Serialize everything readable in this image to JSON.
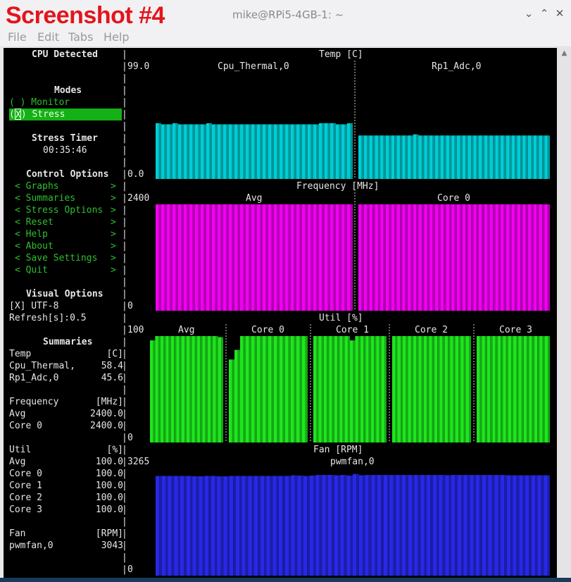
{
  "overlay_label": "Screenshot #4",
  "window": {
    "title": "mike@RPi5-4GB-1: ~",
    "min_icon": "chevron-down-icon",
    "max_icon": "chevron-up-icon",
    "close_icon": "close-icon"
  },
  "menu": [
    "File",
    "Edit",
    "Tabs",
    "Help"
  ],
  "left": {
    "cpu_detected": "CPU Detected",
    "modes_heading": "Modes",
    "mode_monitor": "( ) Monitor",
    "mode_stress_prefix": "(",
    "mode_stress_mark": "X",
    "mode_stress_suffix": ") Stress",
    "stress_timer_heading": "Stress Timer",
    "stress_timer_value": "00:35:46",
    "control_heading": "Control Options",
    "control_items": [
      {
        "label": "< Graphs",
        "arrow": ">"
      },
      {
        "label": "< Summaries",
        "arrow": ">"
      },
      {
        "label": "< Stress Options",
        "arrow": ">"
      },
      {
        "label": "< Reset",
        "arrow": ">"
      },
      {
        "label": "< Help",
        "arrow": ">"
      },
      {
        "label": "< About",
        "arrow": ">"
      },
      {
        "label": "< Save Settings",
        "arrow": ">"
      },
      {
        "label": "< Quit",
        "arrow": ">"
      }
    ],
    "visual_heading": "Visual Options",
    "utf8_option": "[X] UTF-8",
    "refresh": "Refresh[s]:0.5",
    "summaries_heading": "Summaries",
    "summary_rows": [
      {
        "label": "Temp",
        "value": "[C]"
      },
      {
        "label": "Cpu_Thermal,",
        "value": "58.4"
      },
      {
        "label": "Rp1_Adc,0",
        "value": "45.6"
      },
      {
        "label": "",
        "value": ""
      },
      {
        "label": "Frequency",
        "value": "[MHz]"
      },
      {
        "label": "Avg",
        "value": "2400.0"
      },
      {
        "label": "Core 0",
        "value": "2400.0"
      },
      {
        "label": "",
        "value": ""
      },
      {
        "label": "Util",
        "value": "[%]"
      },
      {
        "label": "Avg",
        "value": "100.0"
      },
      {
        "label": "Core 0",
        "value": "100.0"
      },
      {
        "label": "Core 1",
        "value": "100.0"
      },
      {
        "label": "Core 2",
        "value": "100.0"
      },
      {
        "label": "Core 3",
        "value": "100.0"
      },
      {
        "label": "",
        "value": ""
      },
      {
        "label": "Fan",
        "value": "[RPM]"
      },
      {
        "label": "pwmfan,0",
        "value": "3043"
      }
    ]
  },
  "graphs": {
    "temp": {
      "title": "Temp [C]",
      "ymax": "99.0",
      "ymin": "0.0",
      "panels": [
        "Cpu_Thermal,0",
        "Rp1_Adc,0"
      ],
      "color": "#00cdd4"
    },
    "freq": {
      "title": "Frequency [MHz]",
      "ymax": "2400",
      "ymin": "0",
      "panels": [
        "Avg",
        "Core 0"
      ],
      "color": "#f200f2"
    },
    "util": {
      "title": "Util [%]",
      "ymax": "100",
      "ymin": "0",
      "panels": [
        "Avg",
        "Core 0",
        "Core 1",
        "Core 2",
        "Core 3"
      ],
      "color": "#1ee61e"
    },
    "fan": {
      "title": "Fan [RPM]",
      "ymax": "3265",
      "ymin": "0",
      "panels": [
        "pwmfan,0"
      ],
      "color": "#2828e6"
    }
  },
  "chart_data": [
    {
      "type": "bar",
      "title": "Temp [C]",
      "ylim": [
        0,
        99.0
      ],
      "series": [
        {
          "name": "Cpu_Thermal,0",
          "values": [
            58.5,
            57.3,
            57.3,
            58.5,
            57.3,
            57.3,
            57.3,
            57.3,
            57.3,
            58.5,
            57.3,
            57.3,
            57.3,
            57.3,
            57.3,
            57.3,
            57.3,
            57.3,
            57.3,
            57.3,
            57.3,
            57.3,
            57.3,
            57.3,
            57.3,
            57.3,
            57.3,
            57.3,
            57.3,
            58.5,
            58.5,
            58.5,
            57.3,
            57.3,
            58.5
          ]
        },
        {
          "name": "Rp1_Adc,0",
          "values": [
            45.6,
            45.6,
            45.6,
            45.6,
            45.6,
            45.6,
            45.6,
            45.6,
            45.6,
            45.6,
            46.8,
            45.6,
            45.6,
            45.6,
            45.6,
            45.6,
            45.6,
            45.6,
            45.6,
            45.6,
            45.6,
            45.6,
            45.6,
            45.6,
            45.6,
            45.6,
            45.6,
            45.6,
            45.6,
            45.6,
            45.6,
            45.6,
            45.6,
            45.6,
            45.6
          ]
        }
      ]
    },
    {
      "type": "bar",
      "title": "Frequency [MHz]",
      "ylim": [
        0,
        2400
      ],
      "series": [
        {
          "name": "Avg",
          "values": [
            2400,
            2400,
            2400,
            2400,
            2400,
            2400,
            2400,
            2400,
            2400,
            2400,
            2400,
            2400,
            2400,
            2400,
            2400,
            2400,
            2400,
            2400,
            2400,
            2400,
            2400,
            2400,
            2400,
            2400,
            2400,
            2400,
            2400,
            2400,
            2400,
            2400,
            2400,
            2400,
            2400,
            2400,
            2400
          ]
        },
        {
          "name": "Core 0",
          "values": [
            2400,
            2400,
            2400,
            2400,
            2400,
            2400,
            2400,
            2400,
            2400,
            2400,
            2400,
            2400,
            2400,
            2400,
            2400,
            2400,
            2400,
            2400,
            2400,
            2400,
            2400,
            2400,
            2400,
            2400,
            2400,
            2400,
            2400,
            2400,
            2400,
            2400,
            2400,
            2400,
            2400,
            2400,
            2400
          ]
        }
      ]
    },
    {
      "type": "bar",
      "title": "Util [%]",
      "ylim": [
        0,
        100
      ],
      "series": [
        {
          "name": "Avg",
          "values": [
            96,
            100,
            100,
            100,
            100,
            100,
            100,
            100,
            100,
            100,
            100,
            100,
            100,
            99
          ]
        },
        {
          "name": "Core 0",
          "values": [
            78,
            87,
            100,
            100,
            100,
            100,
            100,
            100,
            100,
            100,
            100,
            100,
            100,
            100
          ]
        },
        {
          "name": "Core 1",
          "values": [
            100,
            100,
            100,
            100,
            100,
            100,
            100,
            96,
            100,
            100,
            100,
            100,
            100,
            100
          ]
        },
        {
          "name": "Core 2",
          "values": [
            100,
            100,
            100,
            100,
            100,
            100,
            100,
            100,
            100,
            100,
            100,
            100,
            100,
            100,
            100
          ]
        },
        {
          "name": "Core 3",
          "values": [
            100,
            100,
            100,
            100,
            100,
            100,
            100,
            100,
            100,
            100,
            100,
            100,
            100,
            100
          ]
        }
      ]
    },
    {
      "type": "bar",
      "title": "Fan [RPM]",
      "ylim": [
        0,
        3265
      ],
      "series": [
        {
          "name": "pwmfan,0",
          "values": [
            3020,
            3020,
            3020,
            3020,
            3020,
            3020,
            3010,
            3010,
            3020,
            3020,
            3010,
            3010,
            3020,
            3020,
            3020,
            3020,
            3020,
            3020,
            3020,
            3020,
            3020,
            3020,
            3040,
            3030,
            3020,
            3030,
            3050,
            3050,
            3050,
            3040,
            3050,
            3030,
            3080,
            3040,
            3050,
            3050,
            3050,
            3050,
            3050,
            3050,
            3050,
            3050,
            3050,
            3050,
            3050,
            3050,
            3050,
            3040,
            3050,
            3050,
            3050,
            3050,
            3050,
            3050,
            3050,
            3050,
            3050,
            3040,
            3040,
            3040,
            3040,
            3040,
            3040,
            3040
          ]
        }
      ]
    }
  ]
}
